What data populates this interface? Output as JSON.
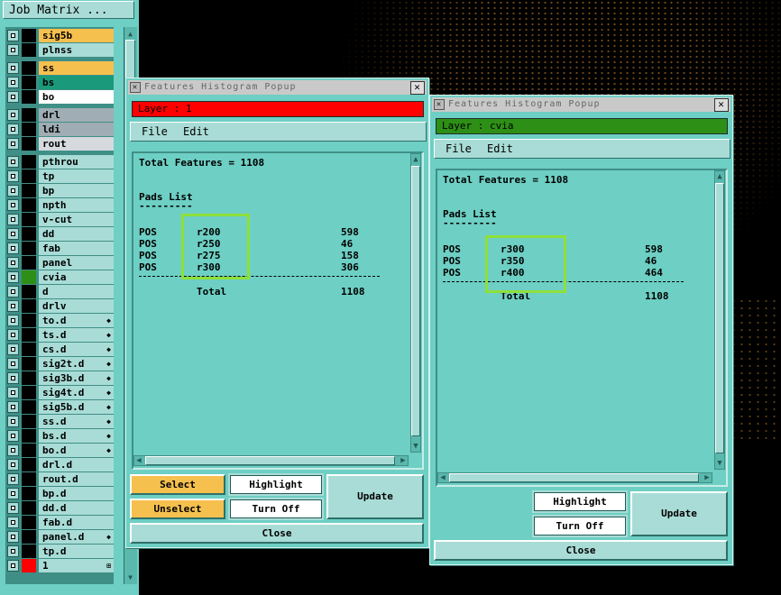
{
  "colors": {
    "teal": "#6ecfc4",
    "light_teal": "#a9dcd6",
    "dark_teal": "#3f8f87",
    "orange": "#f6c04f",
    "green": "#1a9a7a",
    "gray": "#c4c7cb",
    "red": "#ff0000",
    "dark_green": "#2e8f16",
    "highlight": "#8ee03a"
  },
  "matrix": {
    "title": "Job Matrix ...",
    "layers": [
      {
        "name": "sig5b",
        "color": "#f6c04f",
        "mark": ""
      },
      {
        "name": "plnss",
        "color": "#a9dcd6",
        "mark": ""
      },
      {
        "name": "ss",
        "color": "#f6c04f",
        "mark": ""
      },
      {
        "name": "bs",
        "color": "#1a9a7a",
        "mark": ""
      },
      {
        "name": "bo",
        "color": "#ffffff",
        "mark": ""
      },
      {
        "name": "drl",
        "color": "#a0adb4",
        "mark": ""
      },
      {
        "name": "ldi",
        "color": "#a0adb4",
        "mark": ""
      },
      {
        "name": "rout",
        "color": "#d6dade",
        "mark": ""
      },
      {
        "name": "pthrou",
        "color": "#a9dcd6",
        "mark": ""
      },
      {
        "name": "tp",
        "color": "#a9dcd6",
        "mark": ""
      },
      {
        "name": "bp",
        "color": "#a9dcd6",
        "mark": ""
      },
      {
        "name": "npth",
        "color": "#a9dcd6",
        "mark": ""
      },
      {
        "name": "v-cut",
        "color": "#a9dcd6",
        "mark": ""
      },
      {
        "name": "dd",
        "color": "#a9dcd6",
        "mark": ""
      },
      {
        "name": "fab",
        "color": "#a9dcd6",
        "mark": ""
      },
      {
        "name": "panel",
        "color": "#a9dcd6",
        "mark": ""
      },
      {
        "name": "cvia",
        "color": "#a9dcd6",
        "mark": "",
        "swatch": "#2e8f16"
      },
      {
        "name": "d",
        "color": "#a9dcd6",
        "mark": ""
      },
      {
        "name": "drlv",
        "color": "#a9dcd6",
        "mark": ""
      },
      {
        "name": "to.d",
        "color": "#a9dcd6",
        "mark": "◆"
      },
      {
        "name": "ts.d",
        "color": "#a9dcd6",
        "mark": "◆"
      },
      {
        "name": "cs.d",
        "color": "#a9dcd6",
        "mark": "◆"
      },
      {
        "name": "sig2t.d",
        "color": "#a9dcd6",
        "mark": "◆"
      },
      {
        "name": "sig3b.d",
        "color": "#a9dcd6",
        "mark": "◆"
      },
      {
        "name": "sig4t.d",
        "color": "#a9dcd6",
        "mark": "◆"
      },
      {
        "name": "sig5b.d",
        "color": "#a9dcd6",
        "mark": "◆"
      },
      {
        "name": "ss.d",
        "color": "#a9dcd6",
        "mark": "◆"
      },
      {
        "name": "bs.d",
        "color": "#a9dcd6",
        "mark": "◆"
      },
      {
        "name": "bo.d",
        "color": "#a9dcd6",
        "mark": "◆"
      },
      {
        "name": "drl.d",
        "color": "#a9dcd6",
        "mark": ""
      },
      {
        "name": "rout.d",
        "color": "#a9dcd6",
        "mark": ""
      },
      {
        "name": "bp.d",
        "color": "#a9dcd6",
        "mark": ""
      },
      {
        "name": "dd.d",
        "color": "#a9dcd6",
        "mark": ""
      },
      {
        "name": "fab.d",
        "color": "#a9dcd6",
        "mark": ""
      },
      {
        "name": "panel.d",
        "color": "#a9dcd6",
        "mark": "◆"
      },
      {
        "name": "tp.d",
        "color": "#a9dcd6",
        "mark": ""
      },
      {
        "name": "1",
        "color": "#a9dcd6",
        "mark": "⊞",
        "swatch": "#ff0000"
      }
    ]
  },
  "popup1": {
    "title": "Features Histogram Popup",
    "layer": "Layer :  1",
    "menu": {
      "file": "File",
      "edit": "Edit"
    },
    "total_features": "Total Features = 1108",
    "list_title": "Pads List",
    "list_underline": "---------",
    "rows": [
      {
        "type": "POS",
        "sym": "r200",
        "count": "598"
      },
      {
        "type": "POS",
        "sym": "r250",
        "count": "46"
      },
      {
        "type": "POS",
        "sym": "r275",
        "count": "158"
      },
      {
        "type": "POS",
        "sym": "r300",
        "count": "306"
      }
    ],
    "total_label": "Total",
    "total_value": "1108",
    "buttons": {
      "select": "Select",
      "unselect": "Unselect",
      "highlight": "Highlight",
      "turn_off": "Turn Off",
      "update": "Update",
      "close": "Close"
    }
  },
  "popup2": {
    "title": "Features Histogram Popup",
    "layer": "Layer :  cvia",
    "menu": {
      "file": "File",
      "edit": "Edit"
    },
    "total_features": "Total Features = 1108",
    "list_title": "Pads List",
    "list_underline": "---------",
    "rows": [
      {
        "type": "POS",
        "sym": "r300",
        "count": "598"
      },
      {
        "type": "POS",
        "sym": "r350",
        "count": "46"
      },
      {
        "type": "POS",
        "sym": "r400",
        "count": "464"
      }
    ],
    "total_label": "Total",
    "total_value": "1108",
    "buttons": {
      "highlight": "Highlight",
      "turn_off": "Turn Off",
      "update": "Update",
      "close": "Close"
    }
  }
}
